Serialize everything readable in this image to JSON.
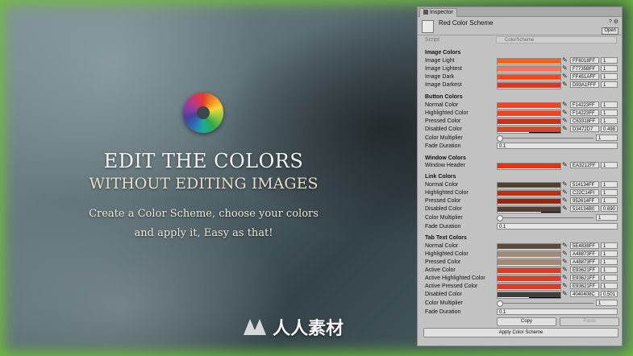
{
  "hero": {
    "title": "EDIT THE COLORS",
    "subtitle": "WITHOUT EDITING IMAGES",
    "line1": "Create a Color Scheme, choose your colors",
    "line2": "and apply it, Easy as that!"
  },
  "watermark": {
    "text": "人人素材"
  },
  "inspector": {
    "tab_label": "Inspector",
    "asset_name": "Red Color Scheme",
    "open_label": "Open",
    "script_label": "Script",
    "script_value": "ColorScheme",
    "sections": {
      "image": {
        "title": "Image Colors",
        "rows": [
          {
            "label": "Image Light",
            "hex": "FF6018FF",
            "alpha": "1",
            "color": "#ff6018"
          },
          {
            "label": "Image Lightest",
            "hex": "F7735BFF",
            "alpha": "1",
            "color": "#f7735b"
          },
          {
            "label": "Image Dark",
            "hex": "FF451AFF",
            "alpha": "1",
            "color": "#ff451a"
          },
          {
            "label": "Image Darkest",
            "hex": "D93A1FFF",
            "alpha": "1",
            "color": "#d93a1f"
          }
        ]
      },
      "button": {
        "title": "Button Colors",
        "rows": [
          {
            "label": "Normal Color",
            "hex": "F14223FF",
            "alpha": "1",
            "color": "#f14223"
          },
          {
            "label": "Highlighted Color",
            "hex": "F14223FF",
            "alpha": "1",
            "color": "#f14223"
          },
          {
            "label": "Pressed Color",
            "hex": "C63318FF",
            "alpha": "1",
            "color": "#c63318"
          },
          {
            "label": "Disabled Color",
            "hex": "D3472D7",
            "alpha": "0.498",
            "color": "#d3472d"
          }
        ],
        "multiplier_label": "Color Multiplier",
        "multiplier": "1",
        "fade_label": "Fade Duration",
        "fade": "0.1"
      },
      "window": {
        "title": "Window Colors",
        "rows": [
          {
            "label": "Window Header",
            "hex": "EA3212FF",
            "alpha": "1",
            "color": "#ea3212"
          }
        ]
      },
      "link": {
        "title": "Link Colors",
        "rows": [
          {
            "label": "Normal Color",
            "hex": "514134FF",
            "alpha": "1",
            "color": "#514134"
          },
          {
            "label": "Highlighted Color",
            "hex": "C22C14FI",
            "alpha": "1",
            "color": "#c22c14"
          },
          {
            "label": "Pressed Color",
            "hex": "952614FF",
            "alpha": "1",
            "color": "#952614"
          },
          {
            "label": "Disabled Color",
            "hex": "514134B0",
            "alpha": "0.690",
            "color": "#514134"
          }
        ],
        "multiplier_label": "Color Multiplier",
        "multiplier": "1",
        "fade_label": "Fade Duration",
        "fade": "0.1"
      },
      "tabtext": {
        "title": "Tab Text Colors",
        "rows": [
          {
            "label": "Normal Color",
            "hex": "5E4838FF",
            "alpha": "1",
            "color": "#5e4838"
          },
          {
            "label": "Highlighted Color",
            "hex": "A48873FF",
            "alpha": "1",
            "color": "#a48873"
          },
          {
            "label": "Pressed Color",
            "hex": "A48873FF",
            "alpha": "1",
            "color": "#a48873"
          },
          {
            "label": "Active Color",
            "hex": "E93621FF",
            "alpha": "1",
            "color": "#e93621"
          },
          {
            "label": "Active Highlighted Color",
            "hex": "E93621FF",
            "alpha": "1",
            "color": "#e93621"
          },
          {
            "label": "Active Pressed Color",
            "hex": "E93621FF",
            "alpha": "1",
            "color": "#e93621"
          },
          {
            "label": "Disabled Color",
            "hex": "4040408C",
            "alpha": "0.501",
            "color": "#404040"
          }
        ],
        "multiplier_label": "Color Multiplier",
        "multiplier": "1",
        "fade_label": "Fade Duration",
        "fade": "0.1"
      }
    },
    "copy_label": "Copy",
    "paste_label": "Paste",
    "apply_label": "Apply Color Scheme"
  }
}
